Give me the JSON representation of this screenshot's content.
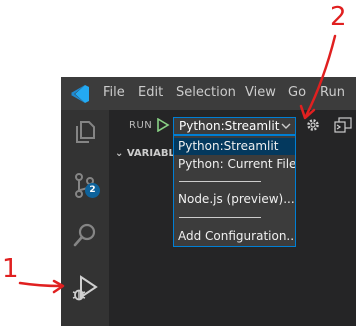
{
  "annotations": {
    "label_1": "1",
    "label_2": "2"
  },
  "menu": [
    "File",
    "Edit",
    "Selection",
    "View",
    "Go",
    "Run"
  ],
  "activity_bar": {
    "icons": [
      "explorer-icon",
      "source-control-icon",
      "search-icon",
      "run-debug-icon"
    ],
    "source_control_badge": "2"
  },
  "run_view": {
    "title": "RUN",
    "selected_configuration": "Python:Streamlit",
    "variables_header": "VARIABLES"
  },
  "dropdown": {
    "options": [
      "Python:Streamlit",
      "Python: Current File",
      "Node.js (preview)...",
      "Add Configuration..."
    ],
    "selected_index": 0
  },
  "colors": {
    "annotation_red": "#e02020",
    "accent_blue": "#007fd4",
    "play_green": "#89d185",
    "badge_blue": "#0e639c"
  }
}
